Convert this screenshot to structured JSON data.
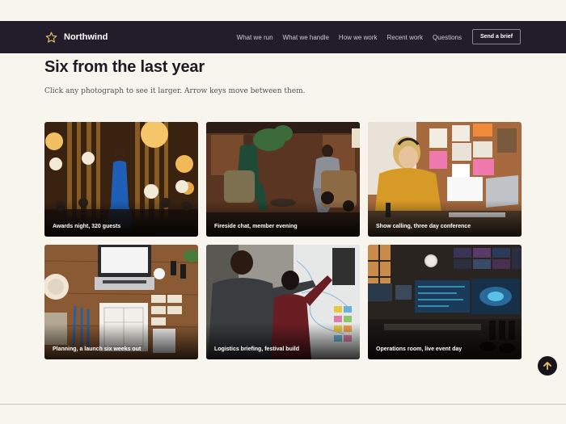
{
  "nav": {
    "brand": "Northwind",
    "brand_icon": "star-outline-icon",
    "links": [
      "What we run",
      "What we handle",
      "How we work",
      "Recent work",
      "Questions"
    ],
    "cta": "Send a brief"
  },
  "section": {
    "title": "Six from the last year",
    "subtitle": "Click any photograph to see it larger. Arrow keys move between them."
  },
  "gallery": [
    {
      "caption": "Awards night, 320 guests"
    },
    {
      "caption": "Fireside chat, member evening"
    },
    {
      "caption": "Show calling, three day conference"
    },
    {
      "caption": "Planning, a launch six weeks out"
    },
    {
      "caption": "Logistics briefing, festival build"
    },
    {
      "caption": "Operations room, live event day"
    }
  ],
  "back_to_top": {
    "icon": "arrow-up-icon"
  },
  "colors": {
    "nav_bg": "#221d2b",
    "page_bg": "#f8f4ee",
    "accent_star": "#e9c46a"
  }
}
